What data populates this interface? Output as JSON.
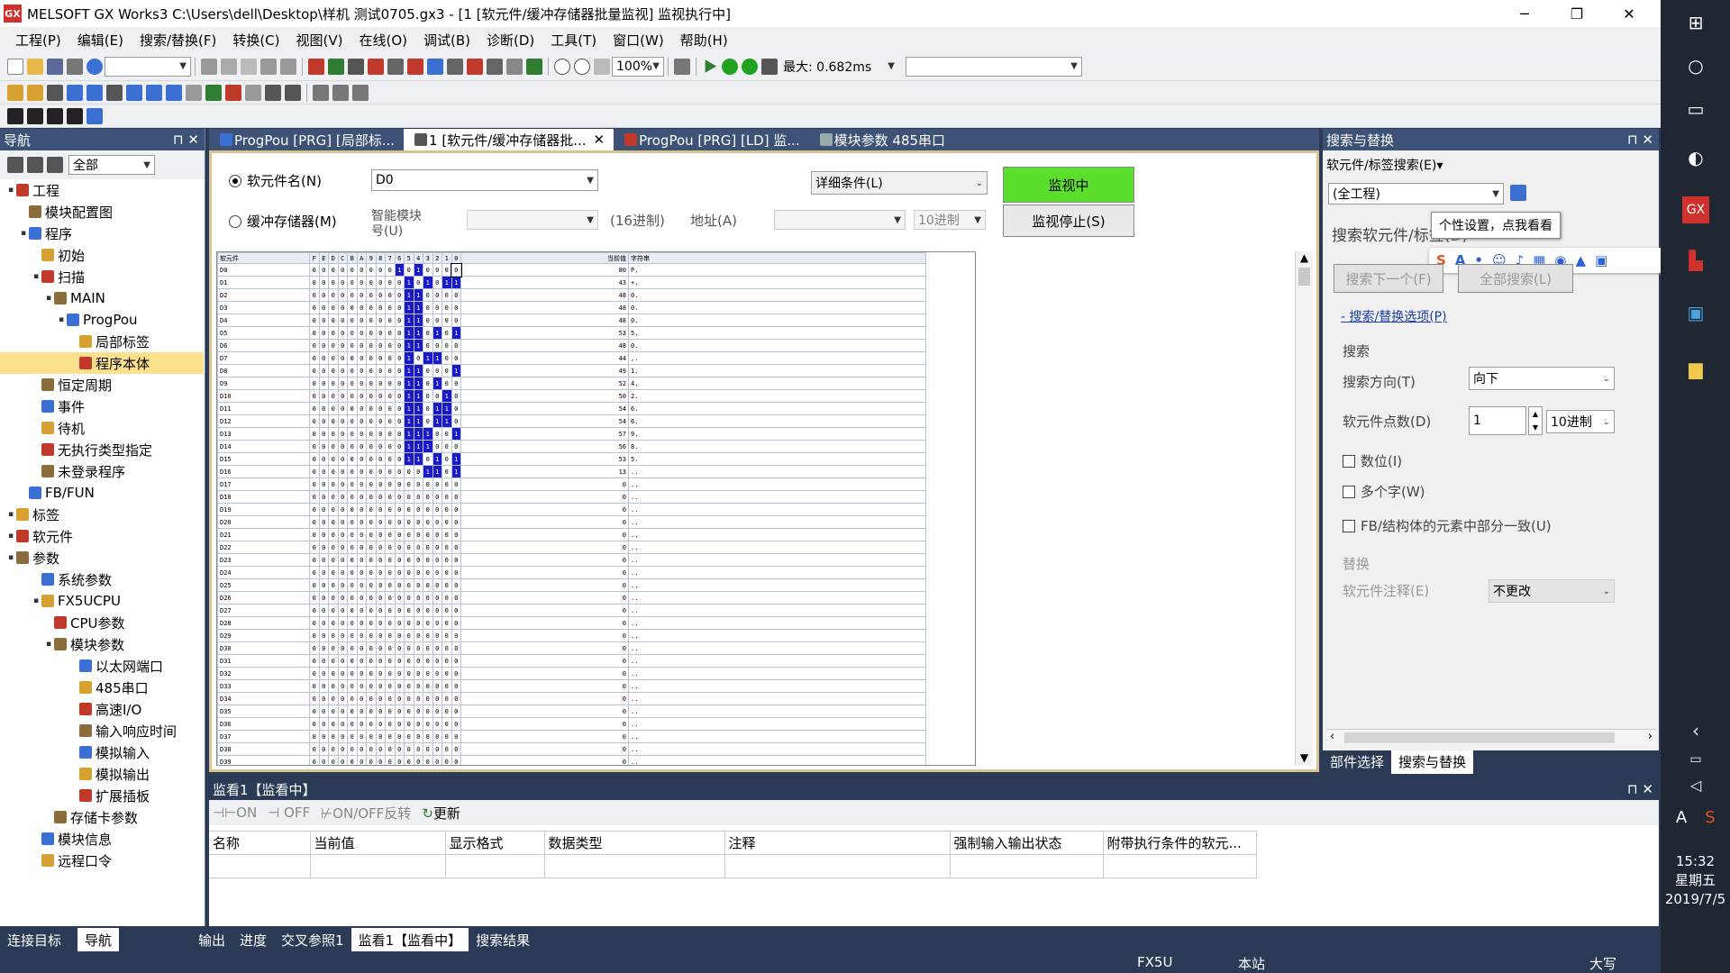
{
  "window": {
    "title": "MELSOFT GX Works3 C:\\Users\\dell\\Desktop\\样机 测试0705.gx3 - [1 [软元件/缓冲存储器批量监视] 监视执行中]",
    "min": "─",
    "max": "❐",
    "close": "✕"
  },
  "menu": [
    "工程(P)",
    "编辑(E)",
    "搜索/替换(F)",
    "转换(C)",
    "视图(V)",
    "在线(O)",
    "调试(B)",
    "诊断(D)",
    "工具(T)",
    "窗口(W)",
    "帮助(H)"
  ],
  "toolbar": {
    "zoom": "100%",
    "scan_time": "最大: 0.682ms"
  },
  "navigation": {
    "title": "导航",
    "filter": "全部",
    "tree": [
      {
        "label": "工程",
        "level": 0,
        "toggle": "▪"
      },
      {
        "label": "模块配置图",
        "level": 1,
        "toggle": ""
      },
      {
        "label": "程序",
        "level": 1,
        "toggle": "▪"
      },
      {
        "label": "初始",
        "level": 2,
        "toggle": ""
      },
      {
        "label": "扫描",
        "level": 2,
        "toggle": "▪"
      },
      {
        "label": "MAIN",
        "level": 3,
        "toggle": "▪"
      },
      {
        "label": "ProgPou",
        "level": 4,
        "toggle": "▪"
      },
      {
        "label": "局部标签",
        "level": 5,
        "toggle": ""
      },
      {
        "label": "程序本体",
        "level": 5,
        "toggle": "",
        "selected": true
      },
      {
        "label": "恒定周期",
        "level": 2,
        "toggle": ""
      },
      {
        "label": "事件",
        "level": 2,
        "toggle": ""
      },
      {
        "label": "待机",
        "level": 2,
        "toggle": ""
      },
      {
        "label": "无执行类型指定",
        "level": 2,
        "toggle": ""
      },
      {
        "label": "未登录程序",
        "level": 2,
        "toggle": ""
      },
      {
        "label": "FB/FUN",
        "level": 1,
        "toggle": ""
      },
      {
        "label": "标签",
        "level": 0,
        "toggle": "▪"
      },
      {
        "label": "软元件",
        "level": 0,
        "toggle": "▪"
      },
      {
        "label": "参数",
        "level": 0,
        "toggle": "▪"
      },
      {
        "label": "系统参数",
        "level": 2,
        "toggle": ""
      },
      {
        "label": "FX5UCPU",
        "level": 2,
        "toggle": "▪"
      },
      {
        "label": "CPU参数",
        "level": 3,
        "toggle": ""
      },
      {
        "label": "模块参数",
        "level": 3,
        "toggle": "▪"
      },
      {
        "label": "以太网端口",
        "level": 5,
        "toggle": ""
      },
      {
        "label": "485串口",
        "level": 5,
        "toggle": ""
      },
      {
        "label": "高速I/O",
        "level": 5,
        "toggle": ""
      },
      {
        "label": "输入响应时间",
        "level": 5,
        "toggle": ""
      },
      {
        "label": "模拟输入",
        "level": 5,
        "toggle": ""
      },
      {
        "label": "模拟输出",
        "level": 5,
        "toggle": ""
      },
      {
        "label": "扩展插板",
        "level": 5,
        "toggle": ""
      },
      {
        "label": "存储卡参数",
        "level": 3,
        "toggle": ""
      },
      {
        "label": "模块信息",
        "level": 2,
        "toggle": ""
      },
      {
        "label": "远程口令",
        "level": 2,
        "toggle": ""
      }
    ]
  },
  "doctabs": [
    "ProgPou [PRG] [局部标...",
    "1 [软元件/缓冲存储器批...",
    "ProgPou [PRG] [LD] 监...",
    "模块参数 485串口"
  ],
  "monitor": {
    "device_label": "软元件名(N)",
    "device_value": "D0",
    "buffer_label": "缓冲存储器(M)",
    "smart_module": "智能模块\n号(U)",
    "hex_note": "(16进制)",
    "address_label": "地址(A)",
    "base": "10进制",
    "detail": "详细条件(L)",
    "monitoring": "监视中",
    "stop": "监视停止(S)"
  },
  "grid": {
    "headers": {
      "device": "软元件",
      "bits": [
        "F",
        "E",
        "D",
        "C",
        "B",
        "A",
        "9",
        "8",
        "7",
        "6",
        "5",
        "4",
        "3",
        "2",
        "1",
        "0"
      ],
      "current": "当前值",
      "string": "字符串"
    },
    "rows": [
      {
        "d": "D0",
        "v": 80,
        "s": "P."
      },
      {
        "d": "D1",
        "v": 43,
        "s": "+."
      },
      {
        "d": "D2",
        "v": 48,
        "s": "0."
      },
      {
        "d": "D3",
        "v": 48,
        "s": "0."
      },
      {
        "d": "D4",
        "v": 48,
        "s": "0."
      },
      {
        "d": "D5",
        "v": 53,
        "s": "5."
      },
      {
        "d": "D6",
        "v": 48,
        "s": "0."
      },
      {
        "d": "D7",
        "v": 44,
        "s": ",."
      },
      {
        "d": "D8",
        "v": 49,
        "s": "1."
      },
      {
        "d": "D9",
        "v": 52,
        "s": "4."
      },
      {
        "d": "D10",
        "v": 50,
        "s": "2."
      },
      {
        "d": "D11",
        "v": 54,
        "s": "6."
      },
      {
        "d": "D12",
        "v": 54,
        "s": "6."
      },
      {
        "d": "D13",
        "v": 57,
        "s": "9."
      },
      {
        "d": "D14",
        "v": 56,
        "s": "8."
      },
      {
        "d": "D15",
        "v": 53,
        "s": "5."
      },
      {
        "d": "D16",
        "v": 13,
        "s": ".."
      },
      {
        "d": "D17",
        "v": 0,
        "s": ".."
      },
      {
        "d": "D18",
        "v": 0,
        "s": ".."
      },
      {
        "d": "D19",
        "v": 0,
        "s": ".."
      },
      {
        "d": "D20",
        "v": 0,
        "s": ".."
      },
      {
        "d": "D21",
        "v": 0,
        "s": ".."
      },
      {
        "d": "D22",
        "v": 0,
        "s": ".."
      },
      {
        "d": "D23",
        "v": 0,
        "s": ".."
      },
      {
        "d": "D24",
        "v": 0,
        "s": ".."
      },
      {
        "d": "D25",
        "v": 0,
        "s": ".."
      },
      {
        "d": "D26",
        "v": 0,
        "s": ".."
      },
      {
        "d": "D27",
        "v": 0,
        "s": ".."
      },
      {
        "d": "D28",
        "v": 0,
        "s": ".."
      },
      {
        "d": "D29",
        "v": 0,
        "s": ".."
      },
      {
        "d": "D30",
        "v": 0,
        "s": ".."
      },
      {
        "d": "D31",
        "v": 0,
        "s": ".."
      },
      {
        "d": "D32",
        "v": 0,
        "s": ".."
      },
      {
        "d": "D33",
        "v": 0,
        "s": ".."
      },
      {
        "d": "D34",
        "v": 0,
        "s": ".."
      },
      {
        "d": "D35",
        "v": 0,
        "s": ".."
      },
      {
        "d": "D36",
        "v": 0,
        "s": ".."
      },
      {
        "d": "D37",
        "v": 0,
        "s": ".."
      },
      {
        "d": "D38",
        "v": 0,
        "s": ".."
      },
      {
        "d": "D39",
        "v": 0,
        "s": ".."
      }
    ]
  },
  "search": {
    "title": "搜索与替换",
    "mode": "软元件/标签搜索(E)▾",
    "scope": "(全工程)",
    "tooltip": "个性设置，点我看看",
    "search_label": "搜索软元件/标签(D)",
    "next": "搜索下一个(F)",
    "all": "全部搜索(L)",
    "options_link": "- 搜索/替换选项(P)",
    "section_search": "搜索",
    "direction_label": "搜索方向(T)",
    "direction_value": "向下",
    "count_label": "软元件点数(D)",
    "count_value": "1",
    "count_base": "10进制",
    "bit": "数位(I)",
    "multiword": "多个字(W)",
    "fb": "FB/结构体的元素中部分一致(U)",
    "section_replace": "替换",
    "comment_label": "软元件注释(E)",
    "comment_value": "不更改",
    "tab_parts": "部件选择",
    "tab_search": "搜索与替换"
  },
  "watch": {
    "title": "监看1【监看中】",
    "on": "ON",
    "off": "OFF",
    "toggle": "ON/OFF反转",
    "update": "更新",
    "columns": [
      "名称",
      "当前值",
      "显示格式",
      "数据类型",
      "注释",
      "强制输入输出状态",
      "附带执行条件的软元..."
    ]
  },
  "bottomtabs": {
    "left": [
      "连接目标",
      "导航"
    ],
    "right": [
      "输出",
      "进度",
      "交叉参照1",
      "监看1【监看中】",
      "搜索结果"
    ]
  },
  "status": {
    "cpu": "FX5U",
    "station": "本站",
    "caps": "大写"
  },
  "taskbar": {
    "time": "15:32",
    "weekday": "星期五",
    "date": "2019/7/5"
  }
}
